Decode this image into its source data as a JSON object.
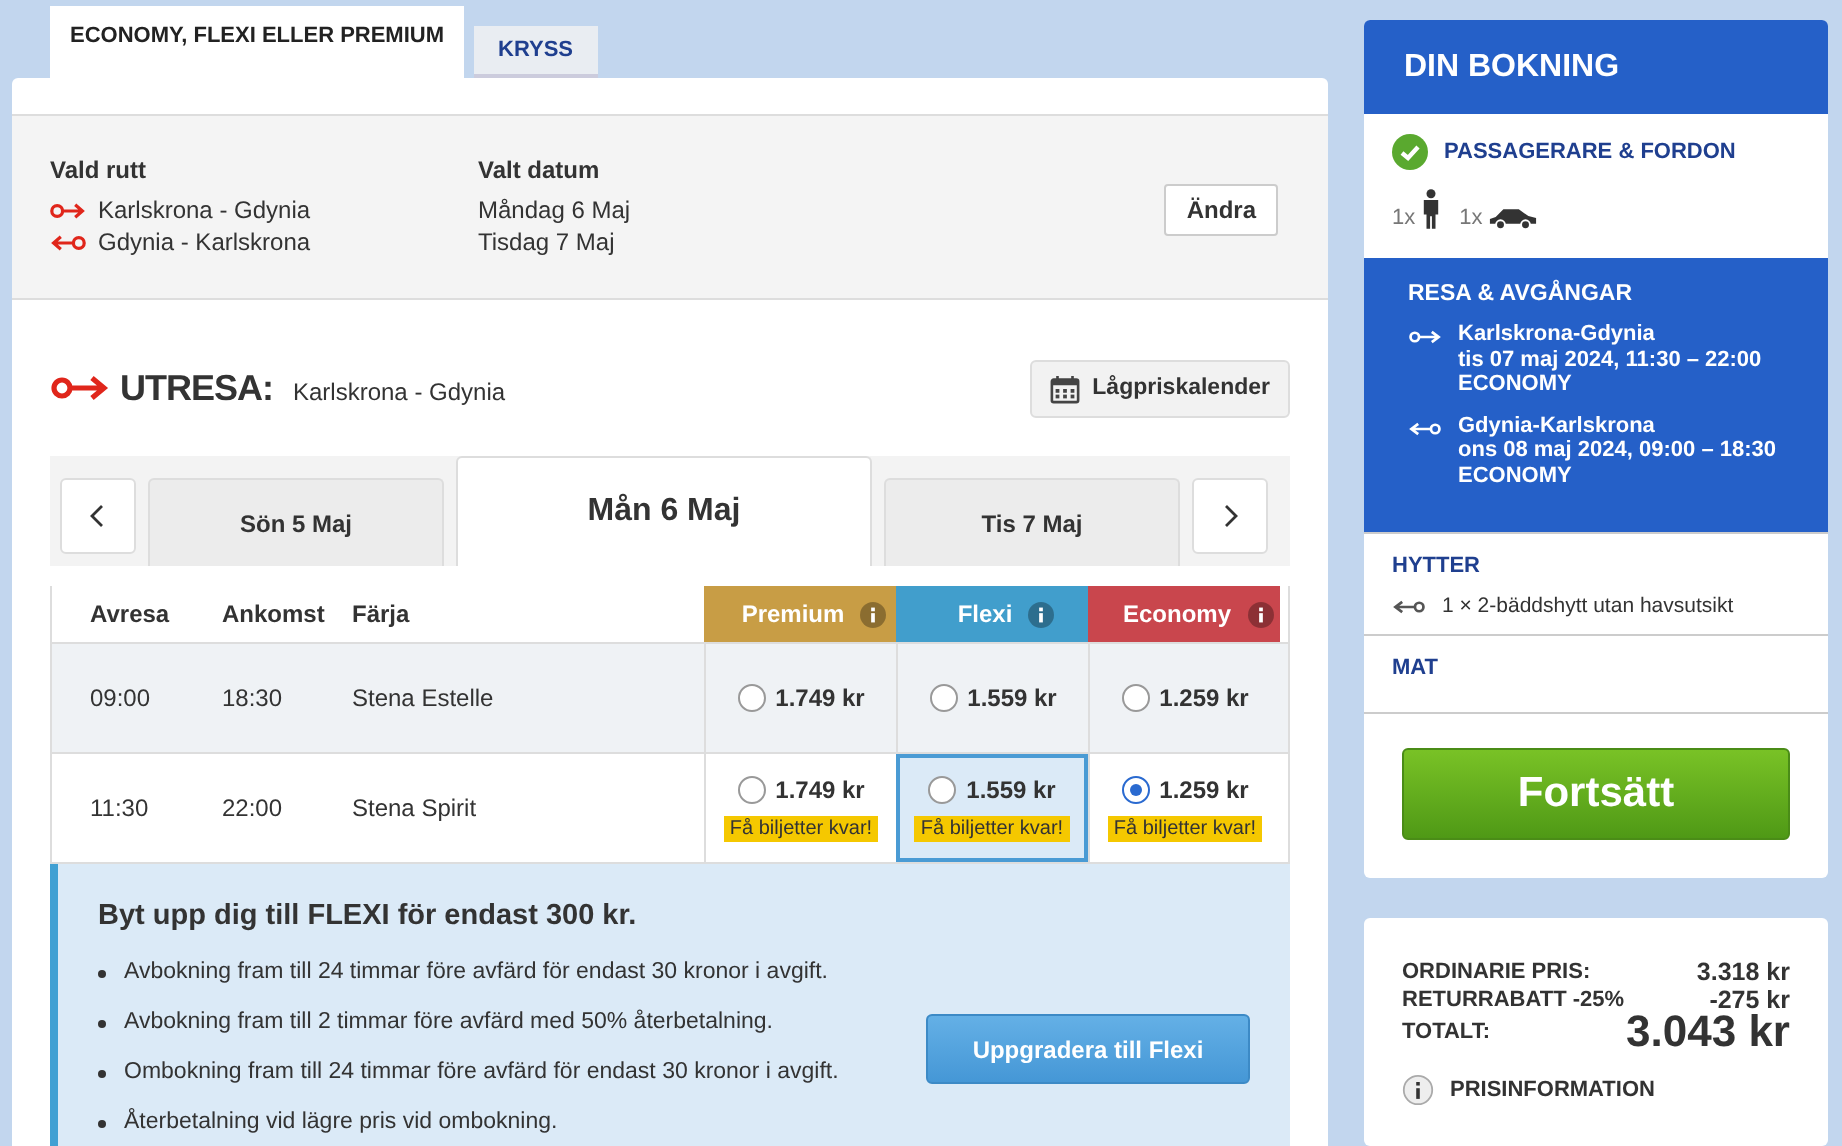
{
  "tabs": [
    {
      "label": "ECONOMY, FLEXI ELLER PREMIUM",
      "selected": true
    },
    {
      "label": "KRYSS",
      "selected": false
    }
  ],
  "route": {
    "route_label": "Vald rutt",
    "routes": [
      {
        "kind": "out",
        "text": "Karlskrona - Gdynia"
      },
      {
        "kind": "return",
        "text": "Gdynia - Karlskrona"
      }
    ],
    "date_label": "Valt datum",
    "dates": [
      "Måndag 6 Maj",
      "Tisdag 7 Maj"
    ],
    "change_button": "Ändra"
  },
  "outbound": {
    "title": "UTRESA:",
    "route": "Karlskrona - Gdynia",
    "calendar_button": "Lågpriskalender"
  },
  "days": [
    {
      "label": "Sön 5 Maj",
      "selected": false
    },
    {
      "label": "Mån 6 Maj",
      "selected": true
    },
    {
      "label": "Tis 7 Maj",
      "selected": false
    }
  ],
  "table": {
    "columns": [
      "Avresa",
      "Ankomst",
      "Färja"
    ],
    "fares": [
      {
        "name": "Premium",
        "color": "#c89d45"
      },
      {
        "name": "Flexi",
        "color": "#419ecc"
      },
      {
        "name": "Economy",
        "color": "#c9464d"
      }
    ],
    "rows": [
      {
        "departure": "09:00",
        "arrival": "18:30",
        "ferry": "Stena Estelle",
        "prices": [
          {
            "price": "1.749 kr",
            "selected": false,
            "focused": false
          },
          {
            "price": "1.559 kr",
            "selected": false,
            "focused": false
          },
          {
            "price": "1.259 kr",
            "selected": false,
            "focused": false
          }
        ]
      },
      {
        "departure": "11:30",
        "arrival": "22:00",
        "ferry": "Stena Spirit",
        "prices": [
          {
            "price": "1.749 kr",
            "selected": false,
            "focused": false,
            "badge": "Få biljetter kvar!"
          },
          {
            "price": "1.559 kr",
            "selected": false,
            "focused": true,
            "badge": "Få biljetter kvar!"
          },
          {
            "price": "1.259 kr",
            "selected": true,
            "focused": false,
            "badge": "Få biljetter kvar!"
          }
        ]
      }
    ]
  },
  "upsell": {
    "title": "Byt upp dig till FLEXI för endast 300 kr.",
    "bullets": [
      "Avbokning fram till 24 timmar före avfärd för endast 30 kronor i avgift.",
      "Avbokning fram till 2 timmar före avfärd med 50% återbetalning.",
      "Ombokning fram till 24 timmar före avfärd för endast 30 kronor i avgift.",
      "Återbetalning vid lägre pris vid ombokning."
    ],
    "button": "Uppgradera till Flexi"
  },
  "booking": {
    "title": "DIN BOKNING",
    "passengers": {
      "title": "PASSAGERARE & FORDON",
      "done": true,
      "counts": [
        {
          "kind": "person",
          "count": "1x"
        },
        {
          "kind": "car",
          "count": "1x"
        }
      ]
    },
    "trip": {
      "title": "RESA & AVGÅNGAR",
      "active": true,
      "legs": [
        {
          "kind": "out",
          "route": "Karlskrona-Gdynia",
          "time": "tis 07 maj 2024, 11:30 – 22:00",
          "fare": "ECONOMY"
        },
        {
          "kind": "return",
          "route": "Gdynia-Karlskrona",
          "time": "ons 08 maj 2024, 09:00 – 18:30",
          "fare": "ECONOMY"
        }
      ]
    },
    "cabins": {
      "title": "HYTTER",
      "items": [
        {
          "kind": "return",
          "text": "1 × 2-bäddshytt utan havsutsikt"
        }
      ]
    },
    "food": {
      "title": "MAT"
    },
    "continue_button": "Fortsätt"
  },
  "price": {
    "rows": [
      {
        "label": "ORDINARIE PRIS:",
        "value": "3.318 kr"
      },
      {
        "label": "RETURRABATT -25%",
        "value": "-275 kr"
      }
    ],
    "total_label": "TOTALT:",
    "total": "3.043 kr",
    "info": "PRISINFORMATION"
  }
}
